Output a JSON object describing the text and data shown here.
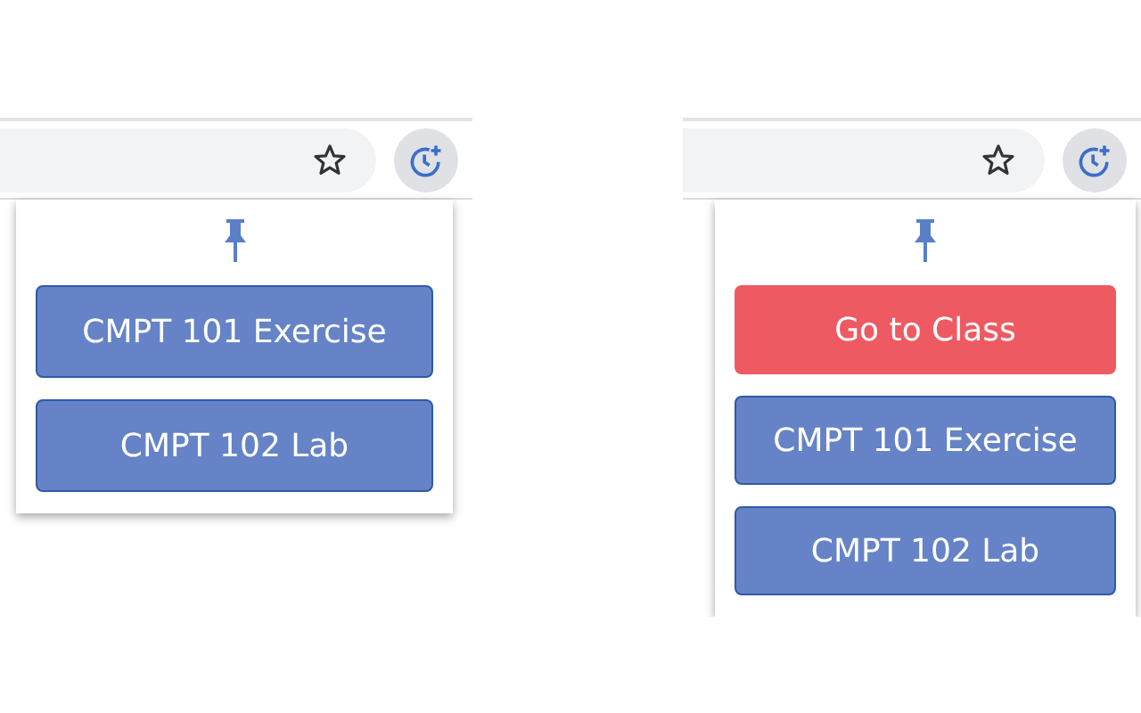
{
  "panels": [
    {
      "popup": {
        "buttons": [
          {
            "kind": "course",
            "label": "CMPT 101 Exercise"
          },
          {
            "kind": "course",
            "label": "CMPT 102 Lab"
          }
        ]
      }
    },
    {
      "popup": {
        "buttons": [
          {
            "kind": "class",
            "label": "Go to Class"
          },
          {
            "kind": "course",
            "label": "CMPT 101 Exercise"
          },
          {
            "kind": "course",
            "label": "CMPT 102 Lab"
          }
        ]
      }
    }
  ]
}
